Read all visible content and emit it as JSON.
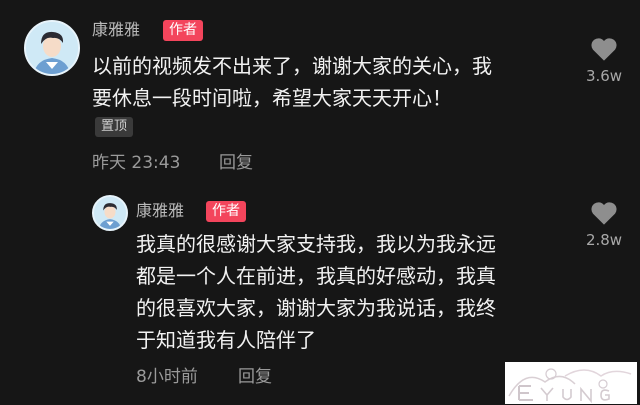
{
  "comments": [
    {
      "username": "康雅雅",
      "badge": "作者",
      "lines": [
        "以前的视频发不出来了，谢谢大家的关心，我",
        "要休息一段时间啦，希望大家天天开心！"
      ],
      "pinned_label": "置顶",
      "time": "昨天 23:43",
      "reply_label": "回复",
      "likes": "3.6w"
    },
    {
      "username": "康雅雅",
      "badge": "作者",
      "lines": [
        "我真的很感谢大家支持我，我以为我永远",
        "都是一个人在前进，我真的好感动，我真",
        "的很喜欢大家，谢谢大家为我说话，我终",
        "于知道我有人陪伴了"
      ],
      "time": "8小时前",
      "reply_label": "回复",
      "likes": "2.8w"
    }
  ],
  "colors": {
    "background": "#161616",
    "author_badge": "#f3455c",
    "like_icon": "#8e8e8e"
  }
}
